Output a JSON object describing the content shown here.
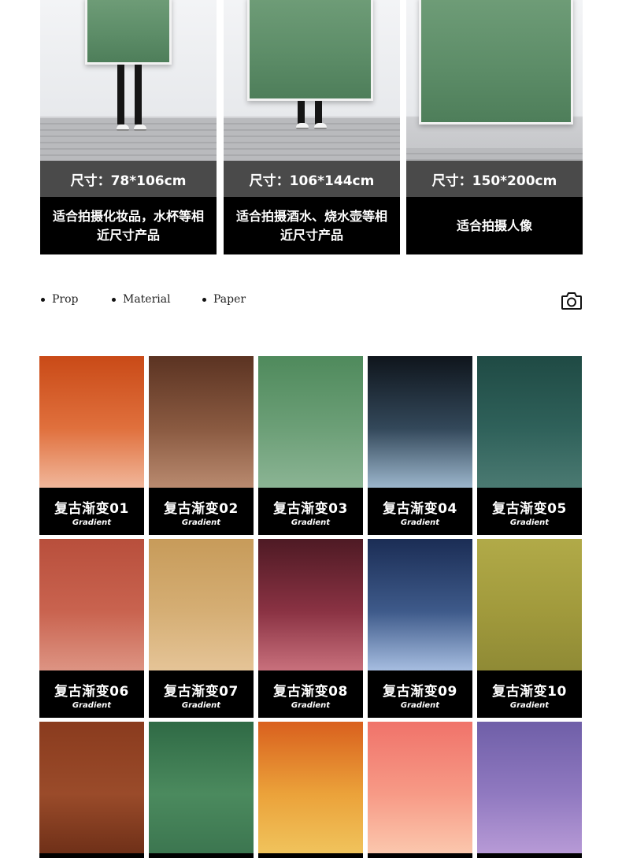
{
  "size_cards": [
    {
      "size_label": "尺寸：78*106cm",
      "use_text": "适合拍摄化妆品，水杯等相近尺寸产品"
    },
    {
      "size_label": "尺寸：106*144cm",
      "use_text": "适合拍摄酒水、烧水壶等相近尺寸产品"
    },
    {
      "size_label": "尺寸：150*200cm",
      "use_text": "适合拍摄人像"
    }
  ],
  "tags": [
    "Prop",
    "Material",
    "Paper"
  ],
  "icons": {
    "camera": "camera-icon"
  },
  "swatches": [
    {
      "name": "复古渐变01",
      "sub": "Gradient",
      "top": "#c94a17",
      "mid": "#e0703d",
      "bottom": "#f1b79b"
    },
    {
      "name": "复古渐变02",
      "sub": "Gradient",
      "top": "#5b3322",
      "mid": "#8a5a41",
      "bottom": "#b98a6f"
    },
    {
      "name": "复古渐变03",
      "sub": "Gradient",
      "top": "#4f8a5c",
      "mid": "#6c9f77",
      "bottom": "#8bb494"
    },
    {
      "name": "复古渐变04",
      "sub": "Gradient",
      "top": "#0f151c",
      "mid": "#33485a",
      "bottom": "#9cb6cc"
    },
    {
      "name": "复古渐变05",
      "sub": "Gradient",
      "top": "#1f4a44",
      "mid": "#2f615a",
      "bottom": "#4b7a72"
    },
    {
      "name": "复古渐变06",
      "sub": "Gradient",
      "top": "#b84f3c",
      "mid": "#c9634f",
      "bottom": "#dd9483"
    },
    {
      "name": "复古渐变07",
      "sub": "Gradient",
      "top": "#c79b5a",
      "mid": "#d5ae74",
      "bottom": "#e5c497"
    },
    {
      "name": "复古渐变08",
      "sub": "Gradient",
      "top": "#4e1a24",
      "mid": "#8a3243",
      "bottom": "#c8707c"
    },
    {
      "name": "复古渐变09",
      "sub": "Gradient",
      "top": "#1b2d55",
      "mid": "#3e5a8a",
      "bottom": "#a6bde0"
    },
    {
      "name": "复古渐变10",
      "sub": "Gradient",
      "top": "#b1aa48",
      "mid": "#a19a3c",
      "bottom": "#8f8a35"
    },
    {
      "name": "",
      "sub": "",
      "top": "#8a3b1e",
      "mid": "#9a4b2a",
      "bottom": "#6f3018"
    },
    {
      "name": "",
      "sub": "",
      "top": "#2f6a45",
      "mid": "#4b8a5e",
      "bottom": "#3c7650"
    },
    {
      "name": "",
      "sub": "",
      "top": "#d9601e",
      "mid": "#eba23a",
      "bottom": "#f0c35c"
    },
    {
      "name": "",
      "sub": "",
      "top": "#f0736a",
      "mid": "#f79a86",
      "bottom": "#fbc7ad"
    },
    {
      "name": "",
      "sub": "",
      "top": "#6f5fa8",
      "mid": "#9079c0",
      "bottom": "#b79ad6"
    }
  ]
}
